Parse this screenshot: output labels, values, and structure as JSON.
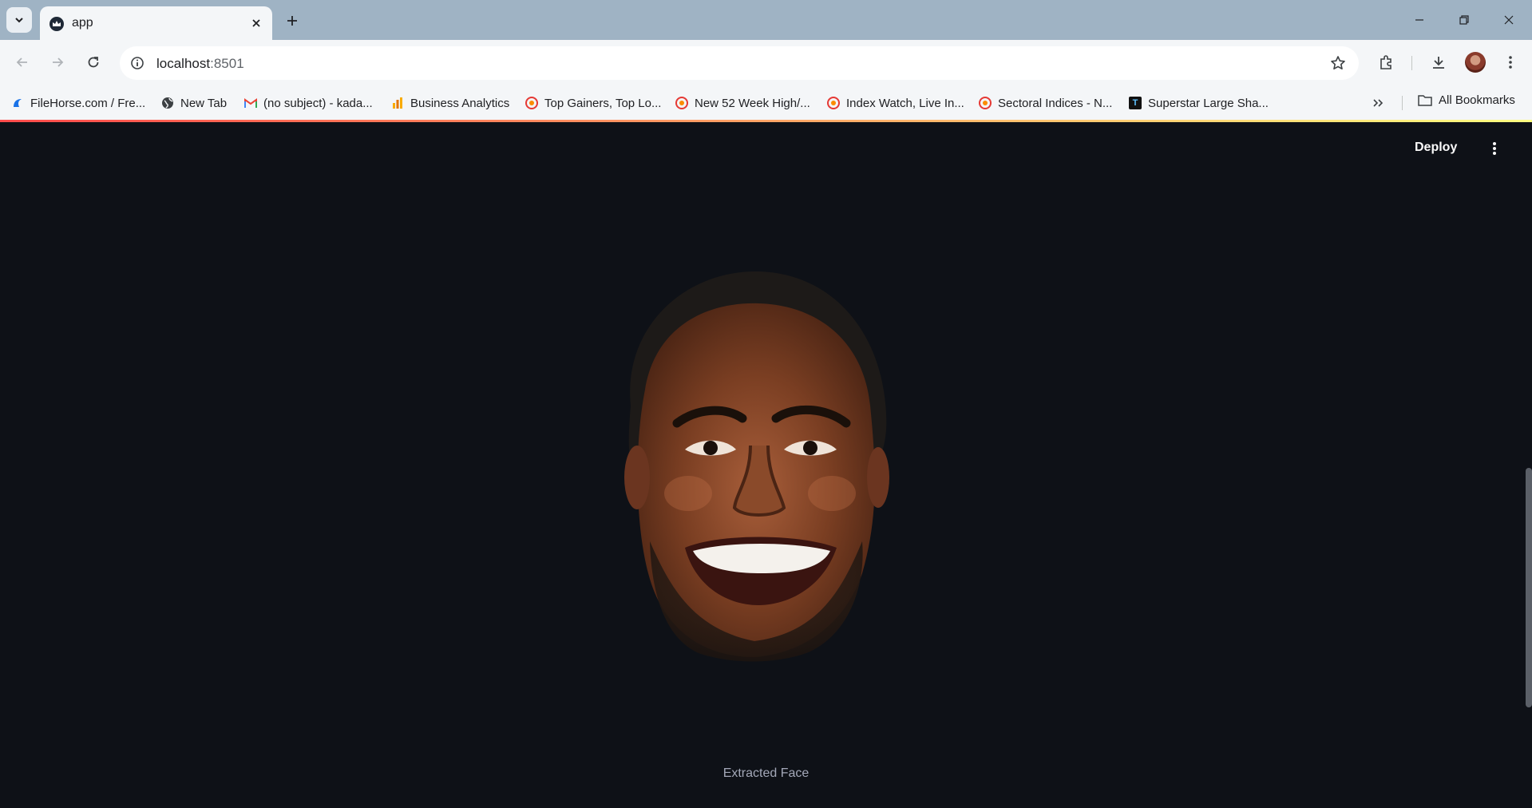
{
  "browser": {
    "tab": {
      "title": "app"
    },
    "address": {
      "host": "localhost",
      "port": ":8501"
    },
    "bookmarks": [
      {
        "label": "FileHorse.com / Fre...",
        "icon": "filehorse-icon"
      },
      {
        "label": "New Tab",
        "icon": "globe-icon"
      },
      {
        "label": "(no subject) - kada...",
        "icon": "gmail-icon"
      },
      {
        "label": "Business Analytics",
        "icon": "analytics-icon"
      },
      {
        "label": "Top Gainers, Top Lo...",
        "icon": "nse-icon"
      },
      {
        "label": "New 52 Week High/...",
        "icon": "nse-icon"
      },
      {
        "label": "Index Watch, Live In...",
        "icon": "nse-icon"
      },
      {
        "label": "Sectoral Indices - N...",
        "icon": "nse-icon"
      },
      {
        "label": "Superstar Large Sha...",
        "icon": "trendlyne-icon"
      }
    ],
    "all_bookmarks_label": "All Bookmarks"
  },
  "app": {
    "deploy_label": "Deploy",
    "image_caption": "Extracted Face",
    "colors": {
      "background": "#0e1117",
      "decoration_start": "#ff4b4b",
      "decoration_end": "#fffd80"
    }
  }
}
